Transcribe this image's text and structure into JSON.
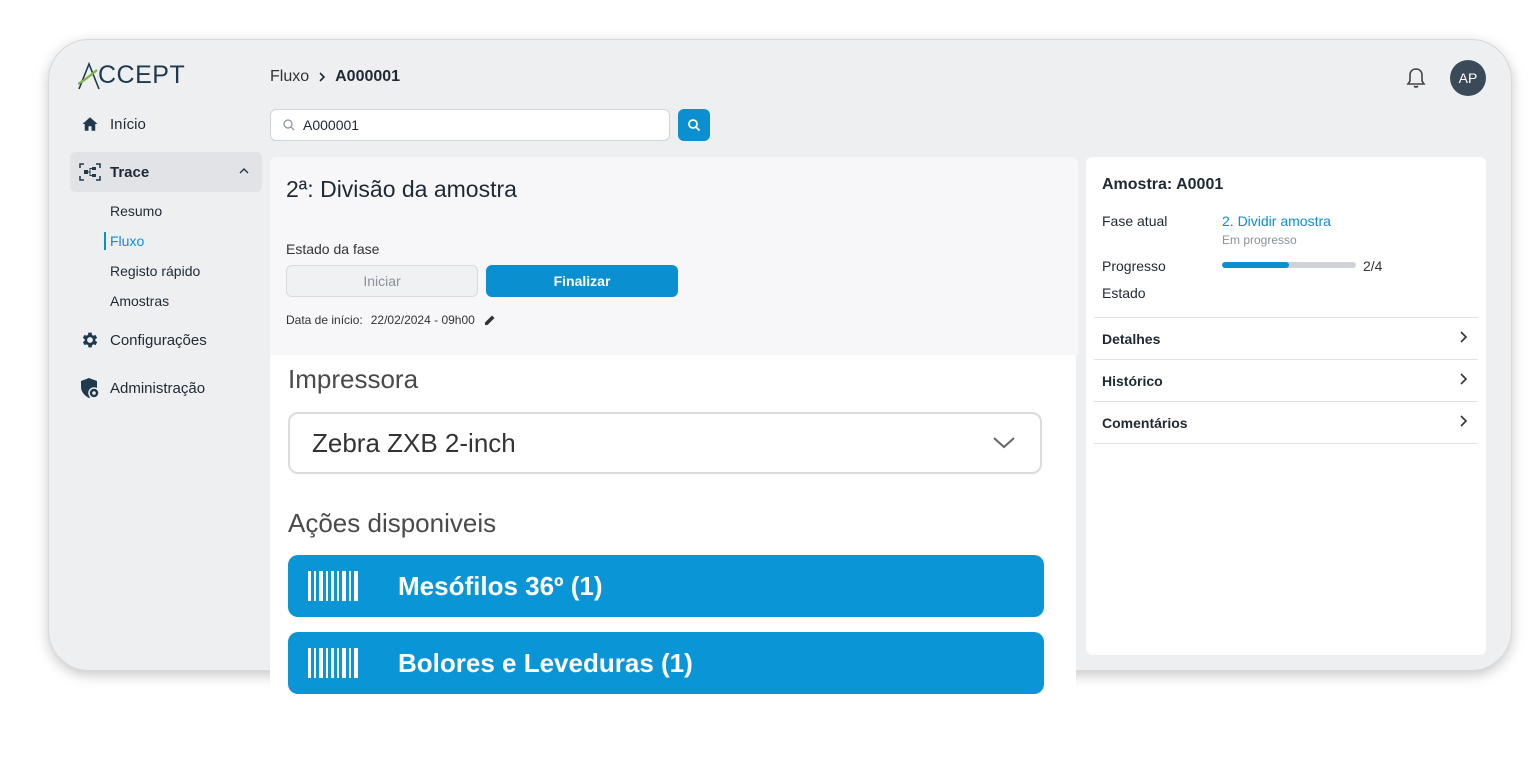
{
  "app": {
    "logo_text": "CCEPT",
    "logo_initial": "A"
  },
  "sidebar": {
    "items": [
      {
        "label": "Início",
        "icon": "home-icon"
      },
      {
        "label": "Trace",
        "icon": "trace-icon"
      },
      {
        "label": "Configurações",
        "icon": "gear-icon"
      },
      {
        "label": "Administração",
        "icon": "shield-icon"
      }
    ],
    "trace_subitems": [
      "Resumo",
      "Fluxo",
      "Registo rápido",
      "Amostras"
    ]
  },
  "header": {
    "breadcrumb": [
      "Fluxo",
      "A000001"
    ],
    "avatar_initials": "AP"
  },
  "search": {
    "value": "A000001"
  },
  "phase": {
    "title": "2ª: Divisão da amostra",
    "state_label": "Estado da fase",
    "start_label": "Iniciar",
    "finish_label": "Finalizar",
    "start_date_label": "Data de início:",
    "start_date_value": "22/02/2024 - 09h00"
  },
  "printer": {
    "label": "Impressora",
    "selected": "Zebra ZXB 2-inch"
  },
  "actions": {
    "label": "Ações disponiveis",
    "items": [
      "Mesófilos 36º (1)",
      "Bolores e Leveduras (1)"
    ]
  },
  "sample_panel": {
    "title": "Amostra: A0001",
    "current_phase_label": "Fase atual",
    "current_phase_value": "2. Dividir amostra",
    "current_phase_status": "Em progresso",
    "progress_label": "Progresso",
    "progress_value": 0.5,
    "progress_text": "2/4",
    "state_label": "Estado",
    "sections": [
      "Detalhes",
      "Histórico",
      "Comentários"
    ]
  },
  "colors": {
    "accent": "#0a8fd0",
    "action": "#0a95d6",
    "avatar": "#3b4a59",
    "logo_green": "#7cb342"
  }
}
